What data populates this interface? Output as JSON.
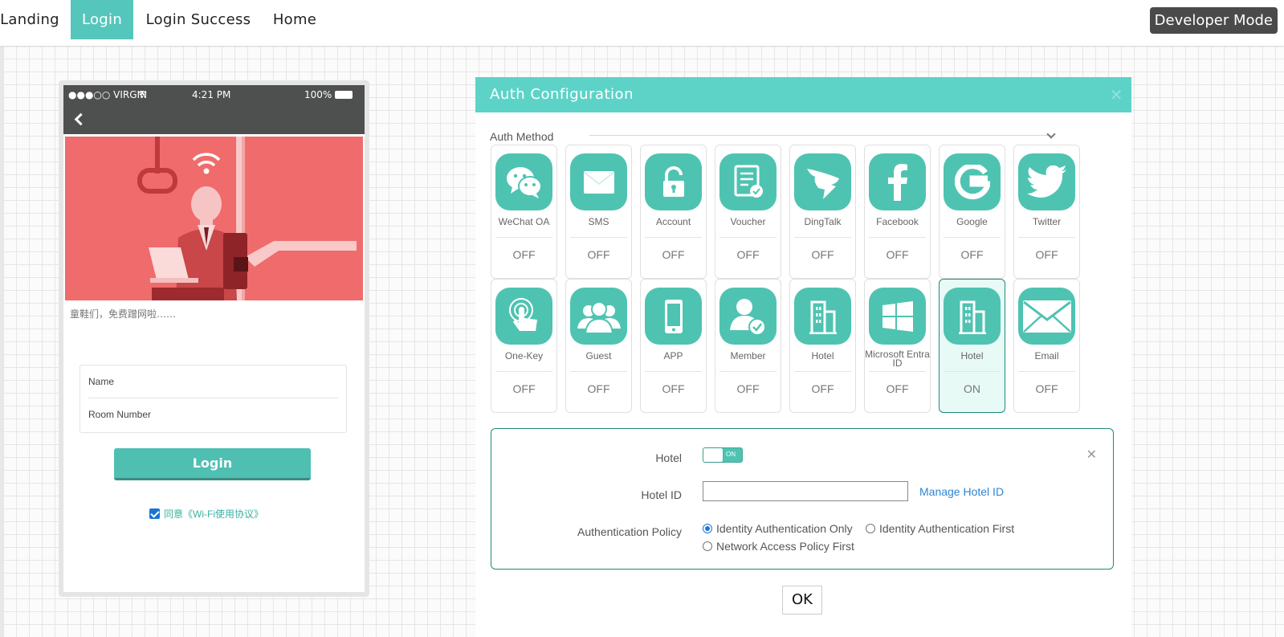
{
  "nav": {
    "tabs": [
      {
        "label": "Landing"
      },
      {
        "label": "Login"
      },
      {
        "label": "Login Success"
      },
      {
        "label": "Home"
      }
    ],
    "active_tab": "Login",
    "developer_mode_label": "Developer Mode"
  },
  "phone": {
    "status": {
      "carrier": "●●●○○ VIRGIN",
      "time": "4:21 PM",
      "battery": "100%"
    },
    "tagline": "童鞋们，免费蹭网啦……",
    "fields": {
      "name": "Name",
      "room": "Room Number"
    },
    "login_button": "Login",
    "agree_text": "同意《Wi-Fi使用协议》",
    "agree_checked": true
  },
  "panel": {
    "title": "Auth Configuration",
    "auth_method_label": "Auth Method",
    "methods": [
      {
        "label": "WeChat OA",
        "status": "OFF",
        "icon": "wechat-icon"
      },
      {
        "label": "SMS",
        "status": "OFF",
        "icon": "sms-icon"
      },
      {
        "label": "Account",
        "status": "OFF",
        "icon": "lock-icon"
      },
      {
        "label": "Voucher",
        "status": "OFF",
        "icon": "voucher-icon"
      },
      {
        "label": "DingTalk",
        "status": "OFF",
        "icon": "dingtalk-icon"
      },
      {
        "label": "Facebook",
        "status": "OFF",
        "icon": "facebook-icon"
      },
      {
        "label": "Google",
        "status": "OFF",
        "icon": "google-icon"
      },
      {
        "label": "Twitter",
        "status": "OFF",
        "icon": "twitter-icon"
      },
      {
        "label": "One-Key",
        "status": "OFF",
        "icon": "one-key-icon"
      },
      {
        "label": "Guest",
        "status": "OFF",
        "icon": "guest-icon"
      },
      {
        "label": "APP",
        "status": "OFF",
        "icon": "phone-icon"
      },
      {
        "label": "Member",
        "status": "OFF",
        "icon": "member-icon"
      },
      {
        "label": "Hotel",
        "status": "OFF",
        "icon": "building-icon"
      },
      {
        "label": "Microsoft Entra ID",
        "status": "OFF",
        "icon": "windows-icon"
      },
      {
        "label": "Hotel",
        "status": "ON",
        "icon": "building-icon"
      },
      {
        "label": "Email",
        "status": "OFF",
        "icon": "email-icon"
      }
    ],
    "config": {
      "hotel_label": "Hotel",
      "toggle_text": "ON",
      "hotel_id_label": "Hotel ID",
      "hotel_id_value": "",
      "manage_link": "Manage Hotel ID",
      "policy_label": "Authentication Policy",
      "policies": [
        {
          "label": "Identity Authentication Only",
          "selected": true
        },
        {
          "label": "Identity Authentication First",
          "selected": false
        },
        {
          "label": "Network Access Policy First",
          "selected": false
        }
      ]
    },
    "ok_label": "OK"
  },
  "colors": {
    "accent": "#55c6bc",
    "icon_bg": "#4fc3b1",
    "header": "#5dd3c8",
    "active_border": "#1e8a79",
    "banner": "#f06b6b",
    "link": "#2f86d1"
  }
}
